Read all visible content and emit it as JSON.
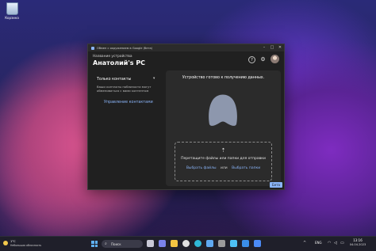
{
  "desktop": {
    "recycle_bin_label": "Корзина"
  },
  "window": {
    "title": "Обмен с окружением в Google (бета)",
    "controls": {
      "minimize": "–",
      "maximize": "□",
      "close": "✕"
    },
    "header": {
      "device_caption": "Название устройства",
      "device_name": "Анатолий's PC",
      "help_glyph": "?",
      "settings_glyph": "⚙"
    },
    "sidebar": {
      "visibility_label": "Только контакты",
      "visibility_chevron": "▾",
      "visibility_desc": "Ваши контакты поблизости могут обмениваться с вами контентом",
      "manage_contacts": "Управление контактами"
    },
    "main": {
      "status": "Устройство готово к получению данных.",
      "upload_glyph": "⇡",
      "drop_hint": "Перетащите файлы или папки для отправки",
      "select_files": "Выбрать файлы",
      "or": "или",
      "select_folders": "Выбрать папки",
      "badge": "Бета"
    },
    "colors": {
      "accent": "#8ab4f8",
      "surface": "#2b2b2b",
      "window_bg": "#202020",
      "blob": "#8d97ad"
    }
  },
  "taskbar": {
    "weather_temp": "1°С",
    "weather_desc": "Небольшая облачность",
    "search_label": "Поиск",
    "search_glyph": "⌕",
    "apps": [
      {
        "name": "task-view-icon",
        "color": "#c9c9d6"
      },
      {
        "name": "teams-icon",
        "color": "#7b83eb"
      },
      {
        "name": "file-explorer-icon",
        "color": "#f4c542"
      },
      {
        "name": "chrome-icon",
        "color": "#e0e0e0"
      },
      {
        "name": "edge-icon",
        "color": "#2fb9d7"
      },
      {
        "name": "store-icon",
        "color": "#5fa8f0"
      },
      {
        "name": "app-icon",
        "color": "#9a9a9a"
      },
      {
        "name": "app-icon",
        "color": "#4ec0f4"
      },
      {
        "name": "app-icon",
        "color": "#3b8ee8"
      },
      {
        "name": "nearby-share-icon",
        "color": "#4c8bf5"
      }
    ],
    "tray_arrow": "^",
    "lang": "ENG",
    "time": "13:16",
    "date": "04.04.2023"
  }
}
